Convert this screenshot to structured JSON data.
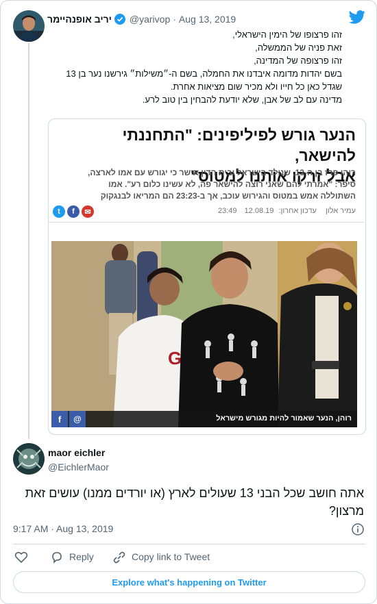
{
  "tweet": {
    "author_name": "יריב אופנהיימר",
    "handle": "@yarivop",
    "separator": "·",
    "date": "Aug 13, 2019",
    "lines": [
      "זהו פרצופו של הימין הישראלי,",
      "זאת פניה של הממשלה,",
      "זהו פרצופה של המדינה,",
      "בשם יהדות מדומה איבדנו את החמלה, בשם ה-״משילות״ גירשנו נער בן 13",
      "שגדל כאן כל חייו ולא מכיר שום מציאות אחרת.",
      "מדינה עם לב של אבן, שלא יודעת להבחין בין טוב לרע."
    ]
  },
  "article": {
    "headline_line1": "הנער גורש לפיליפינים: \"התחננתי להישאר,",
    "headline_line2": "אבל זרקו אותנו למטוס\"",
    "lead_line1": "רוהן פרז בן ה-13, שנולד בישראל ובית הדין אישר כי יגורש עם אמו לארצה,",
    "lead_line2": "סיפר: \"אמרתי להם שאני רוצה להישאר פה, לא עשינו כלום רע\". אמו",
    "lead_line3": "השתוללה אמש במטוס והגירוש עוכב, אך ב-23:23 הם המריאו לבנגקוק",
    "author": "עמיר אלון",
    "updated_label": "עדכון אחרון:",
    "updated_date": "12.08.19",
    "updated_time": "23:49",
    "caption": "רוהן, הנער שאמור להיות מגורש מישראל",
    "photo_shirt_text": "GAP"
  },
  "reply": {
    "author_name": "maor eichler",
    "handle": "@EichlerMaor",
    "text": "אתה חושב שכל הבני 13 שעולים לארץ (או יורדים ממנו) עושים זאת מרצון?",
    "timestamp": "9:17 AM · Aug 13, 2019"
  },
  "actions": {
    "reply_label": "Reply",
    "copy_link_label": "Copy link to Tweet",
    "explore_label": "Explore what's happening on Twitter"
  },
  "colors": {
    "twitter_blue": "#1d9bf0",
    "text_primary": "#0f1419",
    "text_secondary": "#536471",
    "border": "#cfd9de"
  }
}
